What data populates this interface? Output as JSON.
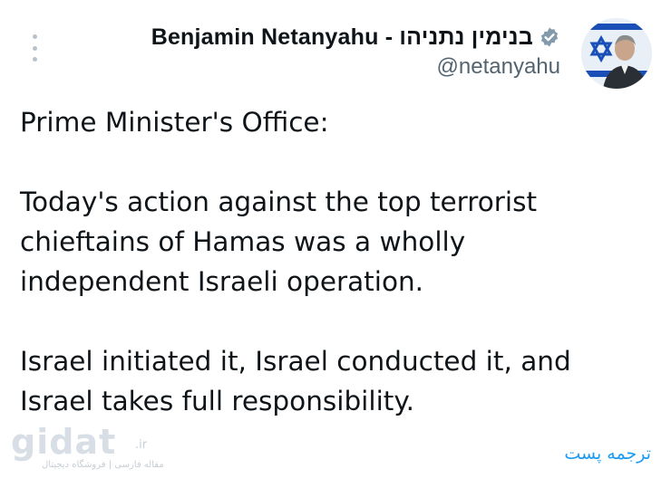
{
  "author": {
    "display_name": "Benjamin Netanyahu - בנימין נתניהו",
    "handle": "@netanyahu",
    "verified": true,
    "verified_icon": "verified-badge-icon",
    "verified_color": "#829aab"
  },
  "tweet": {
    "lines": [
      "Prime Minister's Office:",
      "",
      "Today's action against the top terrorist",
      "chieftains of Hamas was a wholly",
      "independent Israeli operation.",
      "",
      "Israel initiated it, Israel conducted it, and",
      "Israel takes full responsibility."
    ]
  },
  "translate_label": "ترجمه پست",
  "watermark": {
    "logo": "gidat",
    "tld": ".ir",
    "tagline": "مقاله فارسی | فروشگاه دیجیتال"
  },
  "colors": {
    "link": "#1d9bf0",
    "text": "#0f1419",
    "secondary": "#536471"
  }
}
